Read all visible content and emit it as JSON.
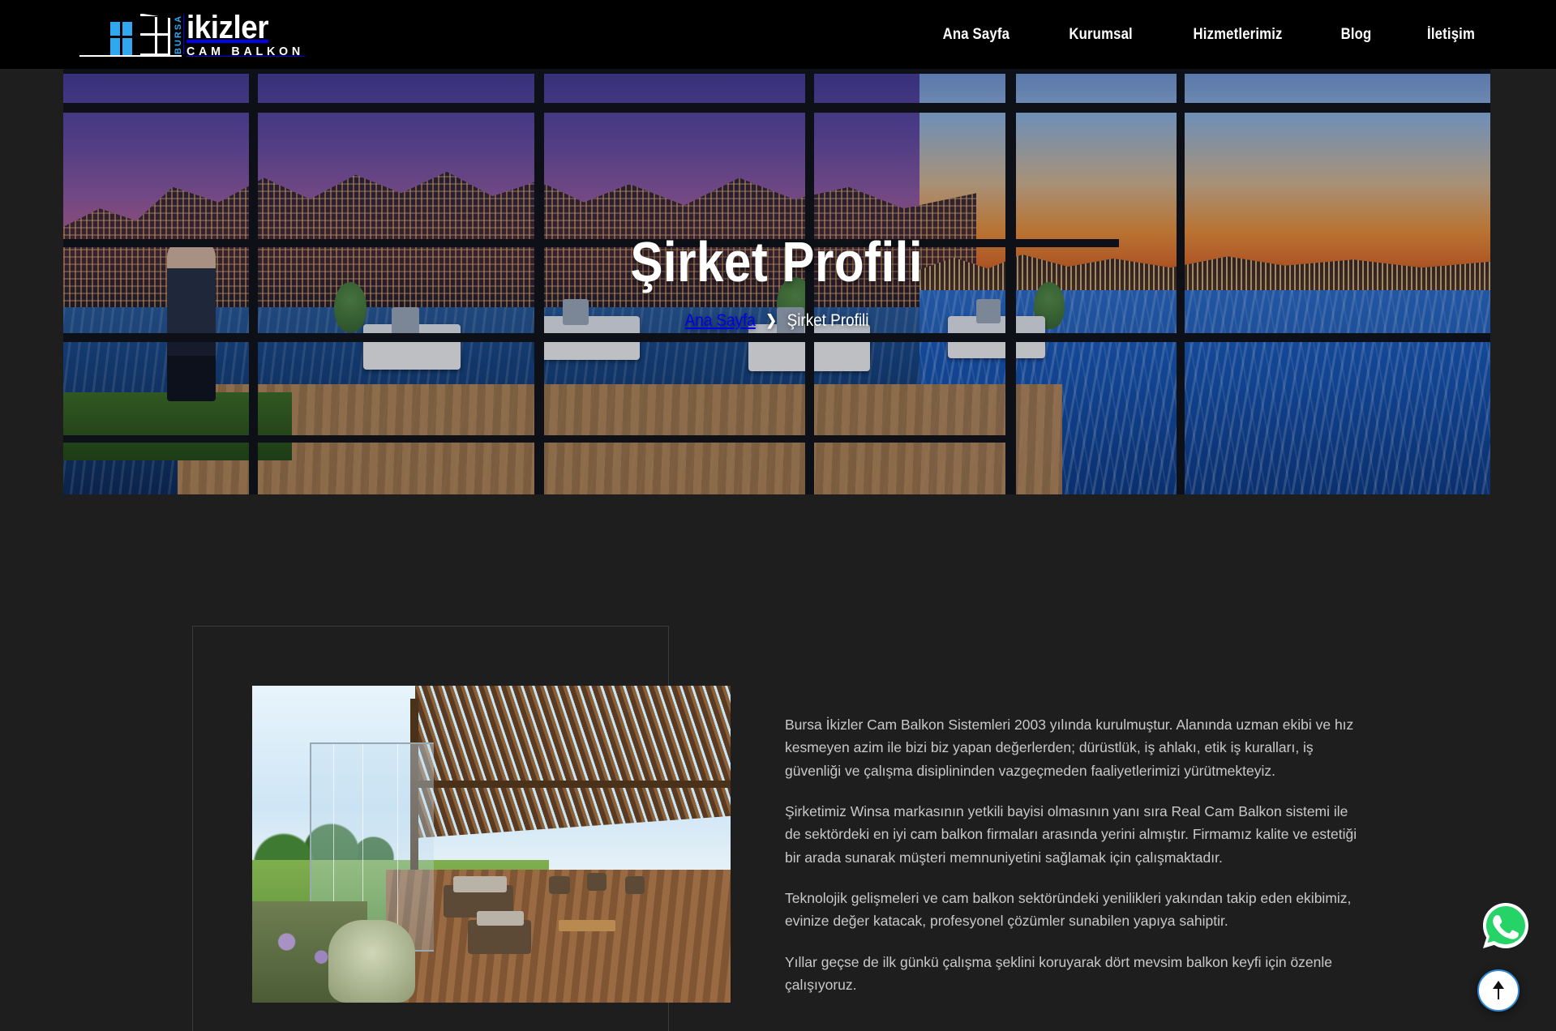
{
  "header": {
    "brand": {
      "vertical_text": "BURSA",
      "main": "ikizler",
      "sub": "CAM BALKON"
    },
    "nav": [
      {
        "label": "Ana Sayfa"
      },
      {
        "label": "Kurumsal"
      },
      {
        "label": "Hizmetlerimiz"
      },
      {
        "label": "Blog"
      },
      {
        "label": "İletişim"
      }
    ]
  },
  "hero": {
    "title": "Şirket Profili",
    "breadcrumb": {
      "home": "Ana Sayfa",
      "separator": "❯",
      "current": "Şirket Profili"
    },
    "image_alt": "Cam balkon ile kapatılmış çatı terası, gün batımında şehir silueti ve deniz manzarası"
  },
  "content": {
    "image_alt": "Ahşap pergola ve sürme cam sistemli bahçe terası",
    "paragraphs": [
      "Bursa İkizler Cam Balkon Sistemleri 2003 yılında kurulmuştur. Alanında uzman ekibi ve hız kesmeyen azim ile bizi biz yapan değerlerden; dürüstlük, iş ahlakı, etik iş kuralları, iş güvenliği ve çalışma disiplininden vazgeçmeden faaliyetlerimizi yürütmekteyiz.",
      "Şirketimiz Winsa markasının yetkili bayisi olmasının yanı sıra Real Cam Balkon sistemi ile de sektördeki en iyi cam balkon firmaları arasında yerini almıştır. Firmamız kalite ve estetiği bir arada sunarak müşteri memnuniyetini sağlamak için çalışmaktadır.",
      "Teknolojik gelişmeleri ve cam balkon sektöründeki yenilikleri yakından takip eden ekibimiz, evinize değer katacak, profesyonel çözümler sunabilen yapıya sahiptir.",
      "Yıllar geçse de ilk günkü çalışma şeklini koruyarak dört mevsim balkon keyfi için özenle çalışıyoruz."
    ]
  },
  "floating": {
    "whatsapp_icon": "whatsapp-icon",
    "scroll_top_icon": "arrow-up-icon"
  },
  "colors": {
    "header_bg": "#000000",
    "page_bg": "#1e1e1e",
    "brand_blue": "#2fa8ef",
    "whatsapp_green": "#25d366",
    "scrolltop_ring": "#2f86d4",
    "body_text": "#c9c9c9"
  }
}
